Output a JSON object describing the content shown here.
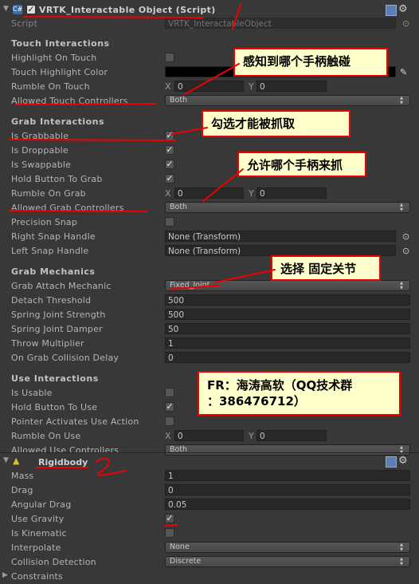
{
  "script_component": {
    "title": "VRTK_Interactable Object (Script)",
    "enabled": true,
    "script_label": "Script",
    "script_value": "VRTK_InteractableObject"
  },
  "sections": [
    {
      "title": "Touch Interactions",
      "rows": [
        {
          "label": "Highlight On Touch",
          "type": "checkbox",
          "checked": false
        },
        {
          "label": "Touch Highlight Color",
          "type": "color",
          "value": "#000000"
        },
        {
          "label": "Rumble On Touch",
          "type": "vector2",
          "x": "0",
          "y": "0"
        },
        {
          "label": "Allowed Touch Controllers",
          "type": "dropdown",
          "value": "Both"
        }
      ]
    },
    {
      "title": "Grab Interactions",
      "rows": [
        {
          "label": "Is Grabbable",
          "type": "checkbox",
          "checked": true
        },
        {
          "label": "Is Droppable",
          "type": "checkbox",
          "checked": true
        },
        {
          "label": "Is Swappable",
          "type": "checkbox",
          "checked": true
        },
        {
          "label": "Hold Button To Grab",
          "type": "checkbox",
          "checked": true
        },
        {
          "label": "Rumble On Grab",
          "type": "vector2",
          "x": "0",
          "y": "0"
        },
        {
          "label": "Allowed Grab Controllers",
          "type": "dropdown",
          "value": "Both"
        },
        {
          "label": "Precision Snap",
          "type": "checkbox",
          "checked": false
        },
        {
          "label": "Right Snap Handle",
          "type": "object",
          "value": "None (Transform)"
        },
        {
          "label": "Left Snap Handle",
          "type": "object",
          "value": "None (Transform)"
        }
      ]
    },
    {
      "title": "Grab Mechanics",
      "rows": [
        {
          "label": "Grab Attach Mechanic",
          "type": "dropdown",
          "value": "Fixed_Joint"
        },
        {
          "label": "Detach Threshold",
          "type": "text",
          "value": "500"
        },
        {
          "label": "Spring Joint Strength",
          "type": "text",
          "value": "500"
        },
        {
          "label": "Spring Joint Damper",
          "type": "text",
          "value": "50"
        },
        {
          "label": "Throw Multiplier",
          "type": "text",
          "value": "1"
        },
        {
          "label": "On Grab Collision Delay",
          "type": "text",
          "value": "0"
        }
      ]
    },
    {
      "title": "Use Interactions",
      "rows": [
        {
          "label": "Is Usable",
          "type": "checkbox",
          "checked": false
        },
        {
          "label": "Hold Button To Use",
          "type": "checkbox",
          "checked": true
        },
        {
          "label": "Pointer Activates Use Action",
          "type": "checkbox",
          "checked": false
        },
        {
          "label": "Rumble On Use",
          "type": "vector2",
          "x": "0",
          "y": "0"
        },
        {
          "label": "Allowed Use Controllers",
          "type": "dropdown",
          "value": "Both"
        }
      ]
    }
  ],
  "rigidbody": {
    "title": "Rigidbody",
    "rows": [
      {
        "label": "Mass",
        "type": "text",
        "value": "1"
      },
      {
        "label": "Drag",
        "type": "text",
        "value": "0"
      },
      {
        "label": "Angular Drag",
        "type": "text",
        "value": "0.05"
      },
      {
        "label": "Use Gravity",
        "type": "checkbox",
        "checked": true
      },
      {
        "label": "Is Kinematic",
        "type": "checkbox",
        "checked": false
      },
      {
        "label": "Interpolate",
        "type": "dropdown",
        "value": "None"
      },
      {
        "label": "Collision Detection",
        "type": "dropdown",
        "value": "Discrete"
      },
      {
        "label": "Constraints",
        "type": "foldout"
      }
    ]
  },
  "annotations": {
    "touch": "感知到哪个手柄触碰",
    "grabbable": "勾选才能被抓取",
    "grab_controllers": "允许哪个手柄来抓",
    "fixed_joint": "选择 固定关节",
    "credit_line1": "FR：海涛高软（QQ技术群",
    "credit_line2": "：386476712）",
    "marker_1": "1",
    "marker_2": "2"
  },
  "colors": {
    "annotation_red": "#e00000",
    "callout_bg": "#ffffcc",
    "panel": "#383838"
  }
}
